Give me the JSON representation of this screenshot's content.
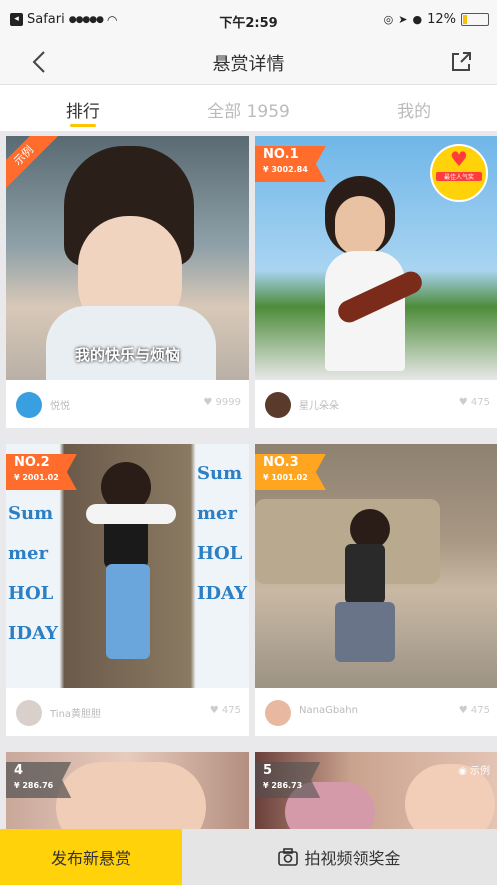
{
  "status_bar": {
    "carrier": "Safari",
    "signal": "●●●●●",
    "time": "下午2:59",
    "battery_percent": "12%"
  },
  "nav": {
    "title": "悬赏详情"
  },
  "tabs": [
    {
      "label": "排行",
      "active": true
    },
    {
      "label": "全部 1959",
      "active": false
    },
    {
      "label": "我的",
      "active": false
    }
  ],
  "cards": [
    {
      "sample_label": "示例",
      "caption": "我的快乐与烦恼",
      "author": "悦悦",
      "likes": "9999"
    },
    {
      "rank": "NO.1",
      "amount": "¥ 3002.84",
      "badge": "最佳人气奖",
      "author": "星儿朵朵",
      "likes": "475"
    },
    {
      "rank": "NO.2",
      "amount": "¥ 2001.02",
      "banner_text": "Summer HOLIDAY",
      "author": "Tina黄胆胆",
      "likes": "475"
    },
    {
      "rank": "NO.3",
      "amount": "¥ 1001.02",
      "author": "NanaGbahn",
      "likes": "475"
    },
    {
      "rank": "4",
      "amount": "¥ 286.76"
    },
    {
      "rank": "5",
      "amount": "¥ 286.73",
      "sample_label": "示例"
    }
  ],
  "footer": {
    "publish_label": "发布新悬赏",
    "shoot_label": "拍视频领奖金"
  },
  "colors": {
    "accent_yellow": "#ffd20a",
    "rank_orange": "#ff6c2c",
    "rank_gold": "#ffa51f"
  }
}
